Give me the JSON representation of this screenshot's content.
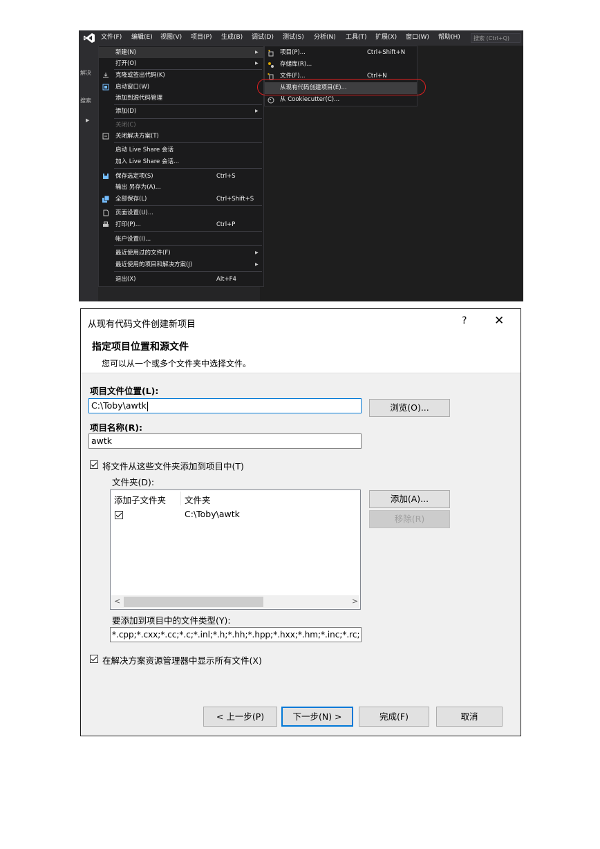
{
  "vs": {
    "menubar": [
      "文件(F)",
      "编辑(E)",
      "视图(V)",
      "项目(P)",
      "生成(B)",
      "调试(D)",
      "测试(S)",
      "分析(N)",
      "工具(T)",
      "扩展(X)",
      "窗口(W)",
      "帮助(H)"
    ],
    "search_placeholder": "搜索 (Ctrl+Q)",
    "left_labels": [
      "解决",
      "搜索"
    ],
    "file_menu": [
      {
        "label": "新建(N)",
        "shortcut": "",
        "submenu": true,
        "icon": "",
        "highlighted": true
      },
      {
        "label": "打开(O)",
        "shortcut": "",
        "submenu": true,
        "icon": ""
      },
      {
        "label": "克隆或签出代码(K)",
        "shortcut": "",
        "icon": "clone-icon"
      },
      {
        "label": "启动窗口(W)",
        "shortcut": "",
        "icon": "start-window-icon"
      },
      {
        "label": "添加到源代码管理",
        "shortcut": "",
        "icon": ""
      },
      {
        "label": "添加(D)",
        "shortcut": "",
        "submenu": true,
        "icon": ""
      },
      {
        "label": "关闭(C)",
        "shortcut": "",
        "icon": "",
        "disabled": true
      },
      {
        "label": "关闭解决方案(T)",
        "shortcut": "",
        "icon": "close-solution-icon"
      },
      {
        "label": "启动 Live Share 会话",
        "shortcut": "",
        "icon": ""
      },
      {
        "label": "加入 Live Share 会话...",
        "shortcut": "",
        "icon": ""
      },
      {
        "label": "保存选定项(S)",
        "shortcut": "Ctrl+S",
        "icon": "save-icon"
      },
      {
        "label": "输出 另存为(A)...",
        "shortcut": "",
        "icon": ""
      },
      {
        "label": "全部保存(L)",
        "shortcut": "Ctrl+Shift+S",
        "icon": "save-all-icon"
      },
      {
        "label": "页面设置(U)...",
        "shortcut": "",
        "icon": "page-setup-icon"
      },
      {
        "label": "打印(P)...",
        "shortcut": "Ctrl+P",
        "icon": "print-icon"
      },
      {
        "label": "帐户设置(I)...",
        "shortcut": "",
        "icon": ""
      },
      {
        "label": "最近使用过的文件(F)",
        "shortcut": "",
        "submenu": true,
        "icon": ""
      },
      {
        "label": "最近使用的项目和解决方案(J)",
        "shortcut": "",
        "submenu": true,
        "icon": ""
      },
      {
        "label": "退出(X)",
        "shortcut": "Alt+F4",
        "icon": ""
      }
    ],
    "new_submenu": [
      {
        "label": "项目(P)...",
        "shortcut": "Ctrl+Shift+N",
        "icon": "new-project-icon"
      },
      {
        "label": "存储库(R)...",
        "shortcut": "",
        "icon": "repository-icon"
      },
      {
        "label": "文件(F)...",
        "shortcut": "Ctrl+N",
        "icon": "new-file-icon"
      },
      {
        "label": "从现有代码创建项目(E)...",
        "shortcut": "",
        "icon": "",
        "highlighted": true
      },
      {
        "label": "从 Cookiecutter(C)...",
        "shortcut": "",
        "icon": "cookiecutter-icon"
      }
    ]
  },
  "dialog": {
    "title": "从现有代码文件创建新项目",
    "help": "?",
    "close": "✕",
    "heading": "指定项目位置和源文件",
    "subheading": "您可以从一个或多个文件夹中选择文件。",
    "location_label": "项目文件位置(L):",
    "location_value": "C:\\Toby\\awtk",
    "browse_button": "浏览(O)...",
    "name_label": "项目名称(R):",
    "name_value": "awtk",
    "add_files_checkbox": "将文件从这些文件夹添加到项目中(T)",
    "folders_label": "文件夹(D):",
    "folders_columns": [
      "添加子文件夹",
      "文件夹"
    ],
    "folders_rows": [
      {
        "checked": true,
        "folder": "C:\\Toby\\awtk"
      }
    ],
    "add_button": "添加(A)...",
    "remove_button": "移除(R)",
    "file_types_label": "要添加到项目中的文件类型(Y):",
    "file_types_value": "*.cpp;*.cxx;*.cc;*.c;*.inl;*.h;*.hh;*.hpp;*.hxx;*.hm;*.inc;*.rc;",
    "show_all_checkbox": "在解决方案资源管理器中显示所有文件(X)",
    "buttons": {
      "back": "< 上一步(P)",
      "next": "下一步(N) >",
      "finish": "完成(F)",
      "cancel": "取消"
    }
  }
}
